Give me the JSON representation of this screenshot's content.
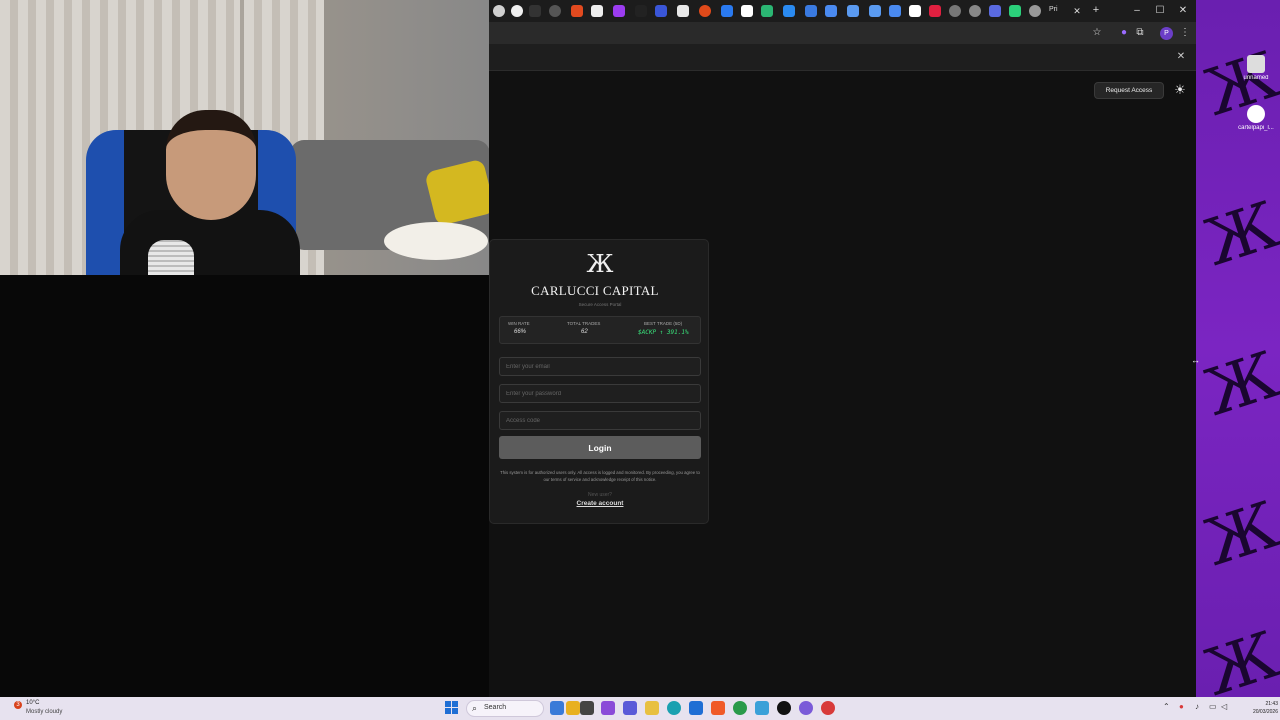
{
  "desktop": {
    "icons": [
      {
        "label": "unnamed"
      },
      {
        "label": "cartelpapi_l..."
      }
    ],
    "wallpaper_color": "#7b25c2",
    "wallpaper_mark": "Ж"
  },
  "browser": {
    "active_tab_title": "Pri",
    "tab_close": "✕",
    "new_tab": "+",
    "window_controls": {
      "minimize": "–",
      "maximize": "☐",
      "close": "✕"
    },
    "toolbar_icons": {
      "bookmark": "☆",
      "extensions": "⧉",
      "menu": "⋮"
    },
    "profile_initial": "P",
    "infobar_close": "✕"
  },
  "page": {
    "request_access": "Request Access",
    "theme_toggle_icon": "☀",
    "card": {
      "logo": "Ж",
      "brand": "CARLUCCI CAPITAL",
      "subtitle": "Secure Access Portal",
      "stats": [
        {
          "label": "WIN RATE",
          "value": "66%"
        },
        {
          "label": "TOTAL TRADES",
          "value": "62"
        },
        {
          "label": "BEST TRADE (5D)",
          "value": "$ACKP ↑ 391.1%"
        }
      ],
      "email_placeholder": "Enter your email",
      "password_placeholder": "Enter your password",
      "access_placeholder": "Access code",
      "login_label": "Login",
      "notice": "This system is for authorized users only. All access is logged and monitored. By proceeding, you agree to our terms of service and acknowledge receipt of this notice.",
      "new_user": "New user?",
      "create_account": "Create account"
    },
    "accent_green": "#39e07a"
  },
  "taskbar": {
    "weather_badge": "3",
    "weather_temp": "10°C",
    "weather_cond": "Mostly cloudy",
    "search_label": "Search",
    "search_icon": "⌕",
    "time": "21:43",
    "date": "20/03/2026"
  }
}
